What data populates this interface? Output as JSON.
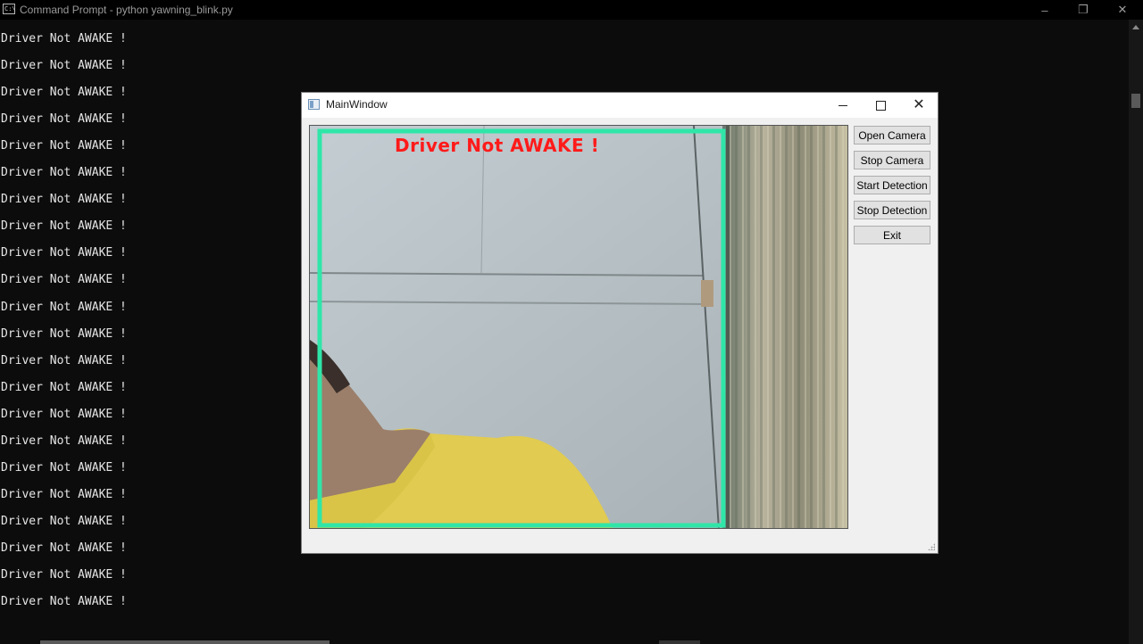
{
  "console_window": {
    "title": "Command Prompt - python  yawning_blink.py",
    "icon_label": "C:\\",
    "minimize_glyph": "–",
    "restore_glyph": "❐",
    "close_glyph": "✕",
    "output_lines": [
      "Driver Not AWAKE !",
      "Driver Not AWAKE !",
      "Driver Not AWAKE !",
      "Driver Not AWAKE !",
      "Driver Not AWAKE !",
      "Driver Not AWAKE !",
      "Driver Not AWAKE !",
      "Driver Not AWAKE !",
      "Driver Not AWAKE !",
      "Driver Not AWAKE !",
      "Driver Not AWAKE !",
      "Driver Not AWAKE !",
      "Driver Not AWAKE !",
      "Driver Not AWAKE !",
      "Driver Not AWAKE !",
      "Driver Not AWAKE !",
      "Driver Not AWAKE !",
      "Driver Not AWAKE !",
      "Driver Not AWAKE !",
      "Driver Not AWAKE !",
      "Driver Not AWAKE !",
      "Driver Not AWAKE !"
    ]
  },
  "main_window": {
    "title": "MainWindow",
    "close_glyph": "✕",
    "video_overlay_text": "Driver Not AWAKE !",
    "buttons": {
      "open_camera": "Open Camera",
      "stop_camera": "Stop Camera",
      "start_detection": "Start Detection",
      "stop_detection": "Stop Detection",
      "exit": "Exit"
    }
  },
  "colors": {
    "console_bg": "#0c0c0c",
    "console_text": "#e6e6e6",
    "detection_box": "#2fe6a8",
    "alert_text": "#ff1a1a"
  }
}
